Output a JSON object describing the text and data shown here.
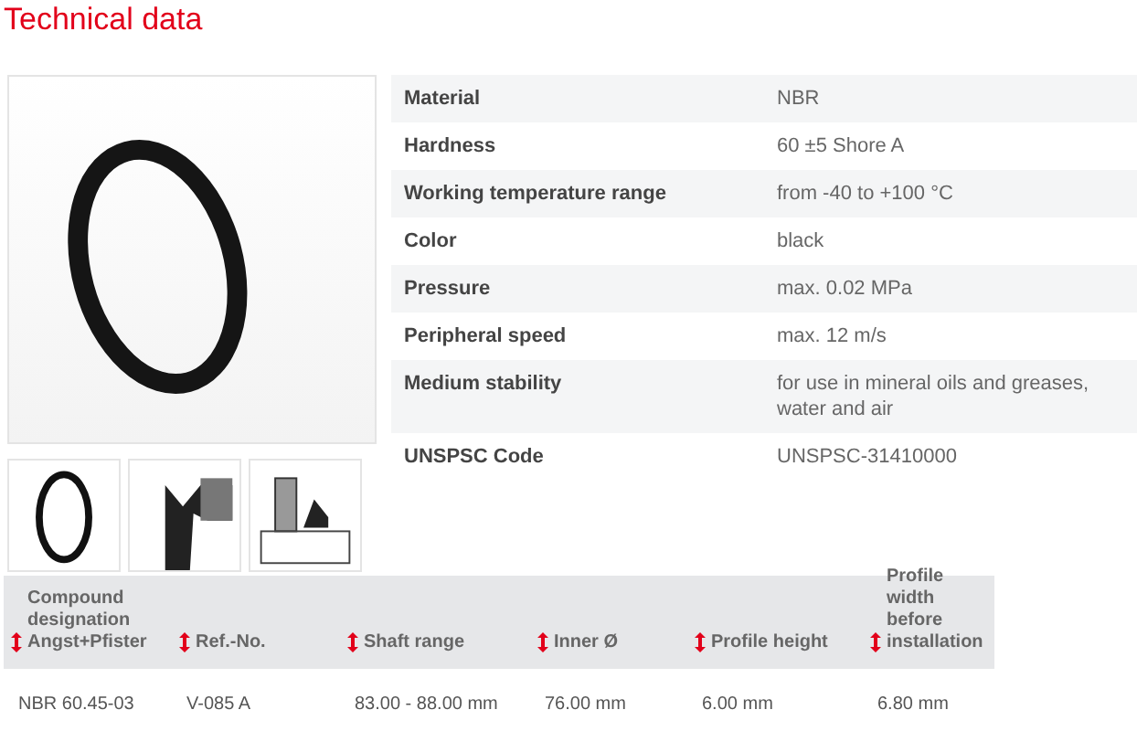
{
  "title": "Technical data",
  "specs": [
    {
      "label": "Material",
      "value": "NBR"
    },
    {
      "label": "Hardness",
      "value": "60 ±5 Shore A"
    },
    {
      "label": "Working temperature range",
      "value": "from -40 to +100 °C"
    },
    {
      "label": "Color",
      "value": "black"
    },
    {
      "label": "Pressure",
      "value": "max. 0.02 MPa"
    },
    {
      "label": "Peripheral speed",
      "value": "max. 12 m/s"
    },
    {
      "label": "Medium stability",
      "value": "for use in mineral oils and greases, water and air"
    },
    {
      "label": "UNSPSC Code",
      "value": "UNSPSC-31410000"
    }
  ],
  "thumbnails": [
    {
      "kind": "ring"
    },
    {
      "kind": "profile"
    },
    {
      "kind": "section"
    }
  ],
  "table": {
    "columns": [
      "Compound designation Angst+Pfister",
      "Ref.-No.",
      "Shaft range",
      "Inner Ø",
      "Profile height",
      "Profile width before installation"
    ],
    "rows": [
      [
        "NBR 60.45-03",
        "V-085 A",
        "83.00 - 88.00 mm",
        "76.00 mm",
        "6.00 mm",
        "6.80 mm"
      ]
    ]
  }
}
